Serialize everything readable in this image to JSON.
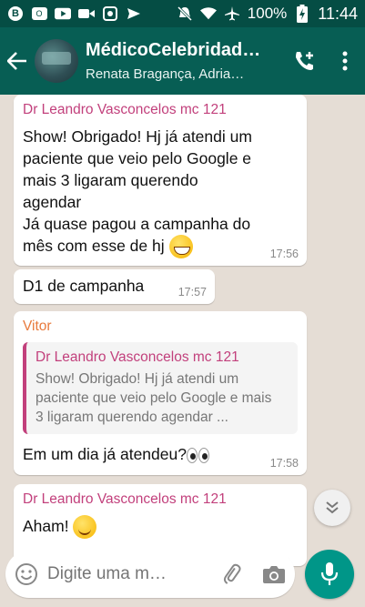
{
  "status_bar": {
    "battery": "100%",
    "time": "11:44",
    "icons": [
      "b-circle-icon",
      "outlook-icon",
      "youtube-icon",
      "video-icon",
      "vpn-icon",
      "send-icon",
      "mute-icon",
      "wifi-icon",
      "airplane-icon",
      "battery-charging-icon"
    ]
  },
  "header": {
    "title": "MédicoCelebridad…",
    "subtitle": "Renata Bragança,  Adria…"
  },
  "messages": [
    {
      "sender": "Dr Leandro Vasconcelos mc 121",
      "lines": [
        "Show! Obrigado! Hj já atendi um",
        "paciente que veio pelo Google e",
        "mais 3 ligaram querendo",
        "agendar",
        "Já quase pagou a campanha do",
        "mês com esse de hj"
      ],
      "time": "17:56"
    },
    {
      "text": "D1 de campanha",
      "time": "17:57"
    },
    {
      "sender": "Vitor",
      "quote_sender": "Dr Leandro Vasconcelos mc 121",
      "quote_lines": [
        "Show! Obrigado! Hj já atendi um",
        "paciente que veio pelo Google e mais",
        "3 ligaram querendo agendar ..."
      ],
      "text": "Em um dia já atendeu?",
      "time": "17:58"
    },
    {
      "sender": "Dr Leandro Vasconcelos mc 121",
      "text": "Aham!"
    }
  ],
  "input": {
    "placeholder": "Digite uma m…"
  },
  "colors": {
    "status_bar": "#054d44",
    "app_bar": "#075e54",
    "chat_bg": "#e5ddd5",
    "sender_pink": "#c2407c",
    "sender_orange": "#e87a3c",
    "mic_button": "#009688"
  }
}
